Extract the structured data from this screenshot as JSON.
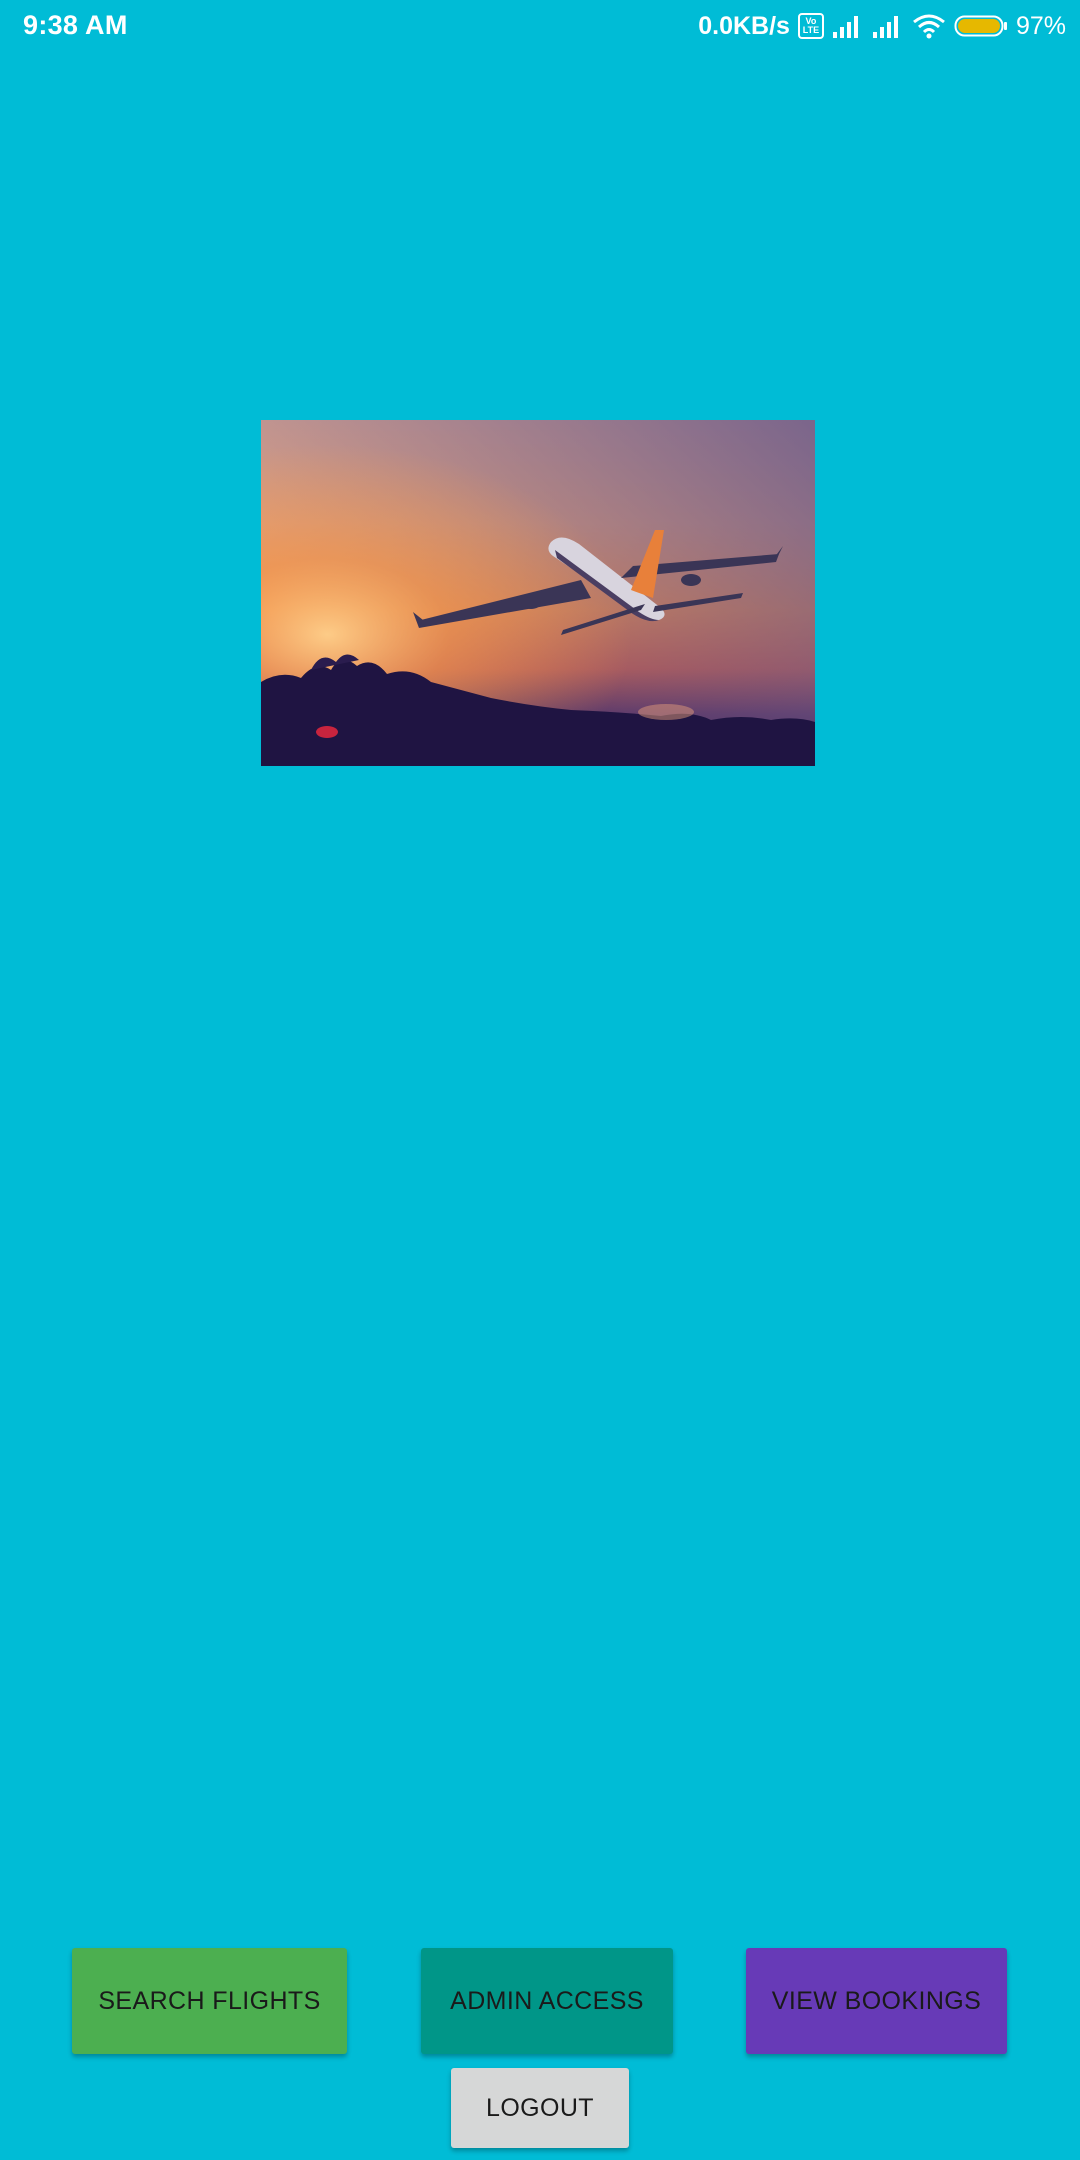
{
  "status_bar": {
    "time": "9:38 AM",
    "net_speed": "0.0KB/s",
    "volte_top": "Vo",
    "volte_bottom": "LTE",
    "battery_percent": "97%",
    "icons": [
      "volte-icon",
      "signal-icon",
      "signal-icon",
      "wifi-icon",
      "battery-icon"
    ]
  },
  "hero": {
    "image": "airplane-sunset-photo"
  },
  "actions": {
    "search_flights": "SEARCH FLIGHTS",
    "admin_access": "ADMIN ACCESS",
    "view_bookings": "VIEW BOOKINGS",
    "logout": "LOGOUT"
  },
  "colors": {
    "background": "#00BCD6",
    "search_button": "#4CAF50",
    "admin_button": "#009688",
    "view_button": "#673AB7",
    "logout_button": "#D6D7D7",
    "battery_fill": "#E6B800"
  }
}
